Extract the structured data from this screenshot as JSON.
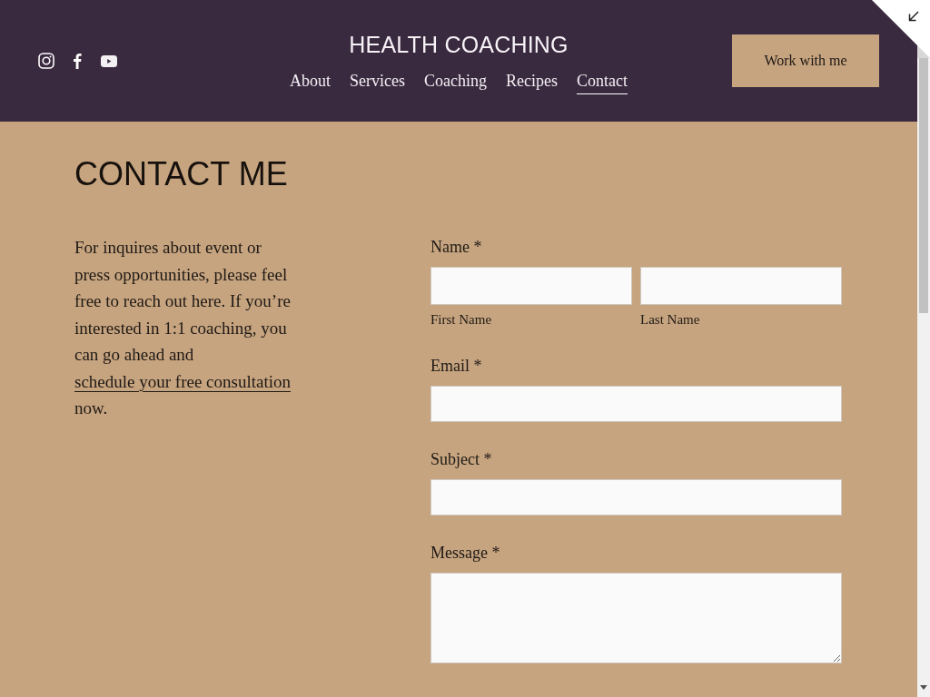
{
  "header": {
    "site_title": "HEALTH COACHING",
    "nav": [
      {
        "label": "About",
        "selected": false
      },
      {
        "label": "Services",
        "selected": false
      },
      {
        "label": "Coaching",
        "selected": false
      },
      {
        "label": "Recipes",
        "selected": false
      },
      {
        "label": "Contact",
        "selected": true
      }
    ],
    "cta_button": "Work with me"
  },
  "page": {
    "heading": "CONTACT ME",
    "intro": {
      "text_before": "For inquires about event or press opportunities, please feel free to reach out here. If you’re interested in 1:1 coaching, you can go ahead and ",
      "link": "schedule your free consultation",
      "text_after": " now."
    }
  },
  "form": {
    "fields": [
      {
        "kind": "name",
        "label": "Name *",
        "parts": [
          {
            "sublabel": "First Name"
          },
          {
            "sublabel": "Last Name"
          }
        ]
      },
      {
        "kind": "text",
        "label": "Email *"
      },
      {
        "kind": "text",
        "label": "Subject *"
      },
      {
        "kind": "textarea",
        "label": "Message *"
      }
    ]
  }
}
